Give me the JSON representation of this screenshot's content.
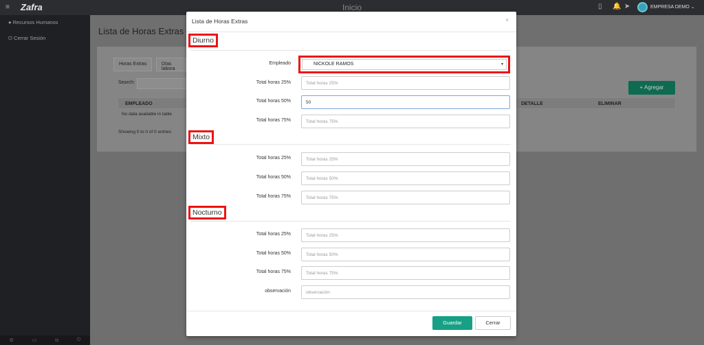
{
  "topbar": {
    "app_name": "Zafra",
    "title": "Inicio",
    "company": "EMPRESA DEMO",
    "icons": [
      "mobile-icon",
      "bell-icon",
      "send-icon"
    ]
  },
  "sidebar": {
    "items": [
      {
        "label": "Recursos Humanos",
        "icon": "user-icon"
      },
      {
        "label": "Cerrar Sesión",
        "icon": "power-icon"
      }
    ]
  },
  "page": {
    "title": "Lista de Horas Extras",
    "tabs": [
      "Horas Extras",
      "Días labora"
    ],
    "search_label": "Search:",
    "add_button": "+ Agregar",
    "columns": [
      "EMPLEADO",
      "DETALLE",
      "ELIMINAR"
    ],
    "empty_text": "No data available in table",
    "showing_text": "Showing 0 to 0 of 0 entries"
  },
  "modal": {
    "title": "Lista de Horas Extras",
    "close": "×",
    "sections": {
      "diurno": "Diurno",
      "mixto": "Mixto",
      "nocturno": "Nocturno"
    },
    "labels": {
      "empleado": "Empleado",
      "h25": "Total horas 25%",
      "h50": "Total horas 50%",
      "h75": "Total horas 75%",
      "observacion": "observación"
    },
    "placeholders": {
      "h25": "Total horas 25%",
      "h50": "Total horas 50%",
      "h75": "Total horas 75%",
      "observacion": "observación"
    },
    "empleado_selected": "NICKOLE RAMOS",
    "diurno_h50_value": "50",
    "save_button": "Guardar",
    "close_button": "Cerrar"
  },
  "colors": {
    "highlight": "#ee1111",
    "save": "#17a085",
    "agregar": "#0e6b51"
  }
}
